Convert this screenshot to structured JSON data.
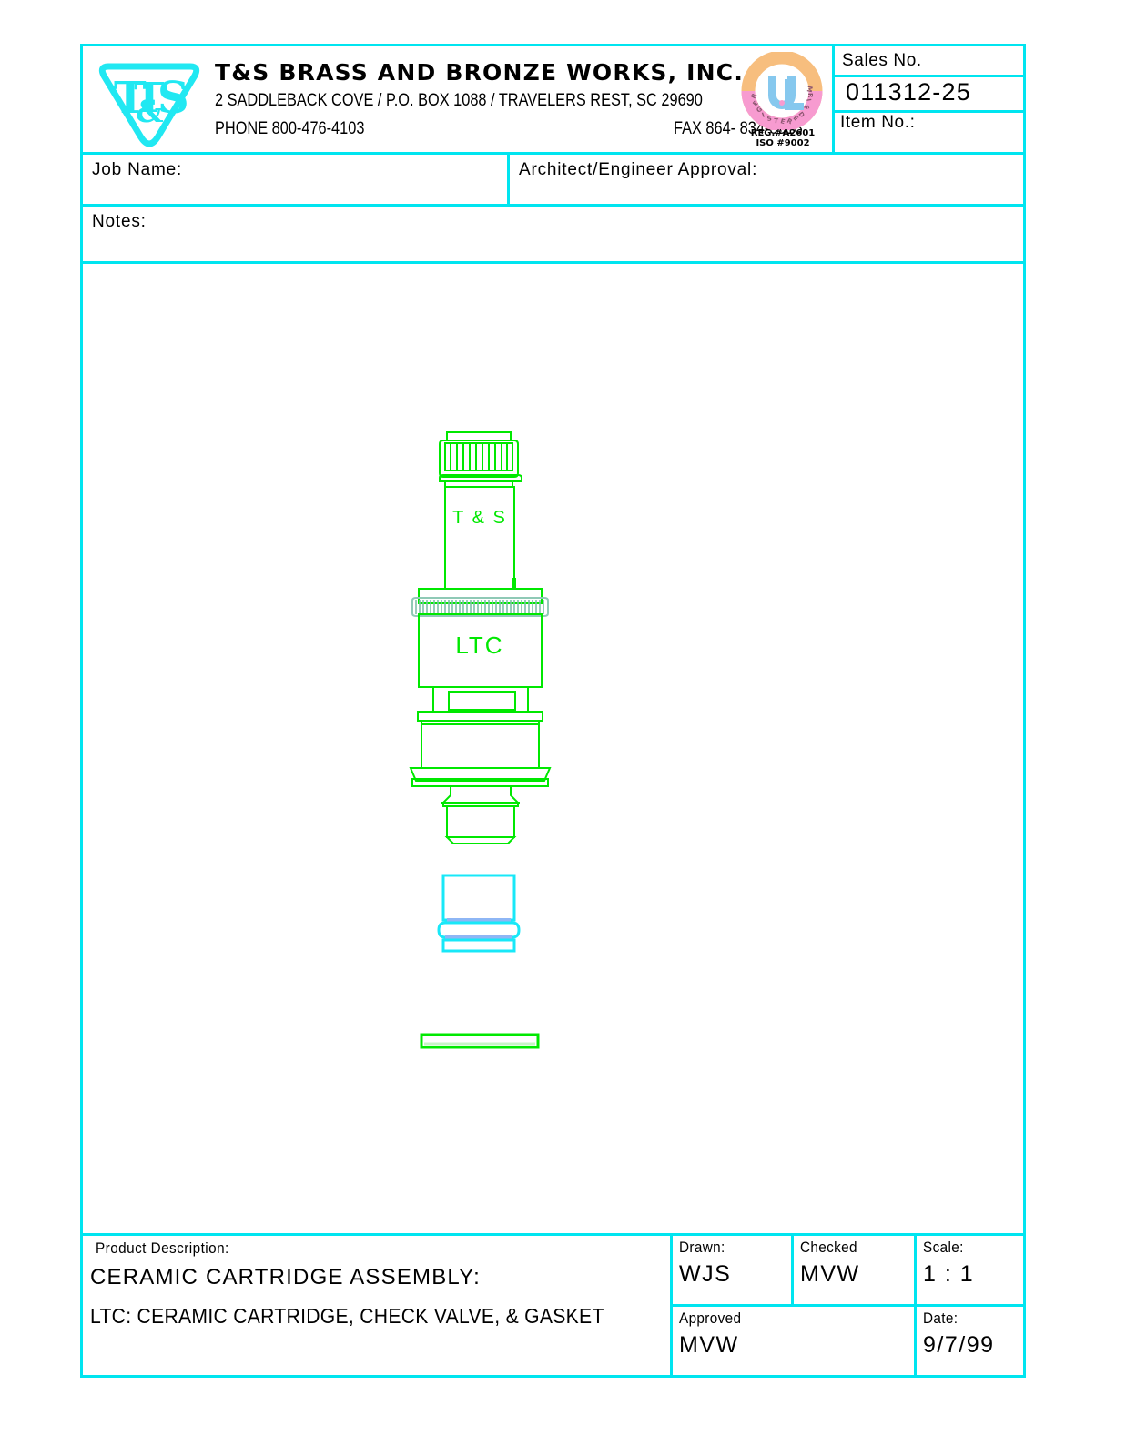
{
  "header": {
    "logo_text": "T&S",
    "logo_icon": "ts-triangle-logo",
    "company_name": "T&S BRASS AND BRONZE WORKS, INC.",
    "address": "2 SADDLEBACK COVE / P.O. BOX 1088 / TRAVELERS REST, SC 29690",
    "phone": "PHONE 800-476-4103",
    "fax": "FAX  864- 834-3518",
    "ul": {
      "mark": "UL",
      "arc_text": "REGISTERED FIRM",
      "reg_line1": "REG.#A2601",
      "reg_line2": "ISO  #9002"
    },
    "sales_label": "Sales No.",
    "sales_value": "011312-25",
    "item_label": "Item No.:"
  },
  "form": {
    "job_name_label": "Job Name:",
    "job_name_value": "",
    "architect_label": "Architect/Engineer Approval:",
    "architect_value": "",
    "notes_label": "Notes:",
    "notes_value": ""
  },
  "drawing": {
    "cap_label": "T & S",
    "body_label": "LTC",
    "parts": [
      {
        "name": "ceramic-cartridge",
        "label": "LTC"
      },
      {
        "name": "check-valve",
        "label": ""
      },
      {
        "name": "gasket",
        "label": ""
      }
    ]
  },
  "title_block": {
    "description_label": "Product Description:",
    "description_line1": "CERAMIC CARTRIDGE ASSEMBLY:",
    "description_line2": "LTC: CERAMIC CARTRIDGE, CHECK VALVE, & GASKET",
    "drawn_label": "Drawn:",
    "drawn_value": "WJS",
    "checked_label": "Checked",
    "checked_value": "MVW",
    "scale_label": "Scale:",
    "scale_value": "1 : 1",
    "approved_label": "Approved",
    "approved_value": "MVW",
    "date_label": "Date:",
    "date_value": "9/7/99"
  },
  "colors": {
    "frame": "#00E5F0",
    "line_green": "#00E800",
    "knurl_teal": "#7FBFA8",
    "valve_cyan": "#18E8F8",
    "logo_cyan": "#21E8F2",
    "ul_orange": "#F7BE7E",
    "ul_pink": "#F79BD0",
    "ul_blue": "#86C8EE"
  }
}
